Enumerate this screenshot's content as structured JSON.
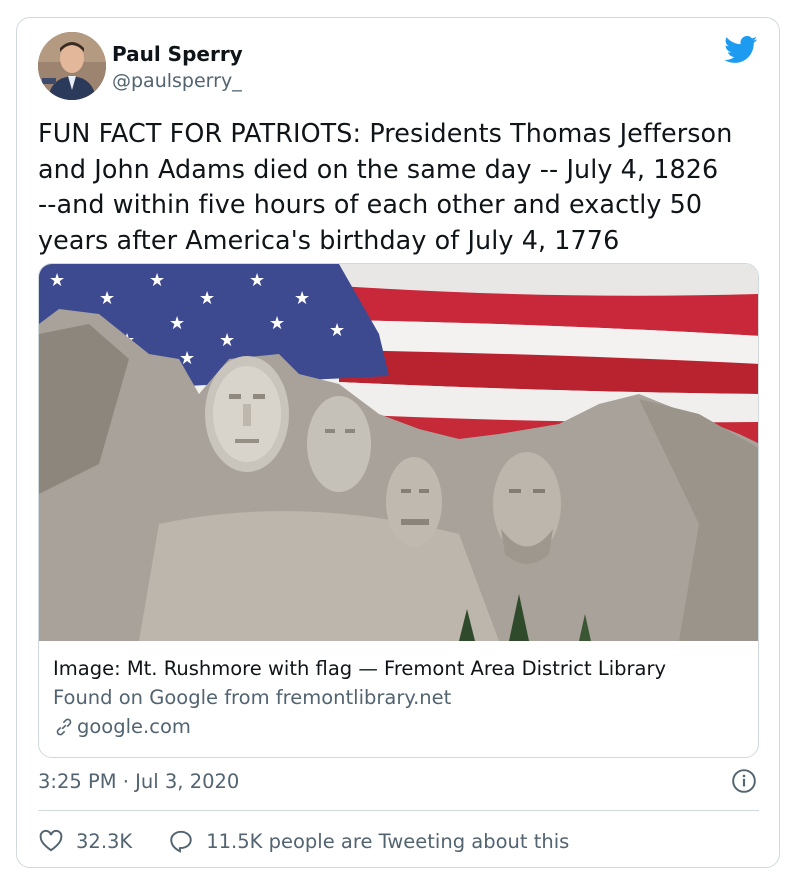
{
  "author": {
    "name": "Paul Sperry",
    "handle": "@paulsperry_"
  },
  "tweet": {
    "lines": [
      "FUN FACT FOR PATRIOTS: Presidents Thomas Jefferson",
      "and John Adams died on the same day -- July 4, 1826",
      "--and within five hours of each other and exactly 50",
      "years after America's birthday of July 4, 1776"
    ]
  },
  "media": {
    "caption": "Image: Mt. Rushmore with flag — Fremont Area District Library",
    "source": "Found on Google from fremontlibrary.net",
    "domain": "google.com"
  },
  "meta": {
    "timestamp": "3:25 PM · Jul 3, 2020"
  },
  "actions": {
    "likes": "32.3K",
    "tweeting": "11.5K people are Tweeting about this"
  },
  "colors": {
    "twitter_blue": "#1d9bf0",
    "secondary_text": "#536471",
    "border": "#cfd9de"
  },
  "icons": [
    "twitter-bird-icon",
    "link-icon",
    "info-icon",
    "heart-icon",
    "reply-bubble-icon"
  ]
}
